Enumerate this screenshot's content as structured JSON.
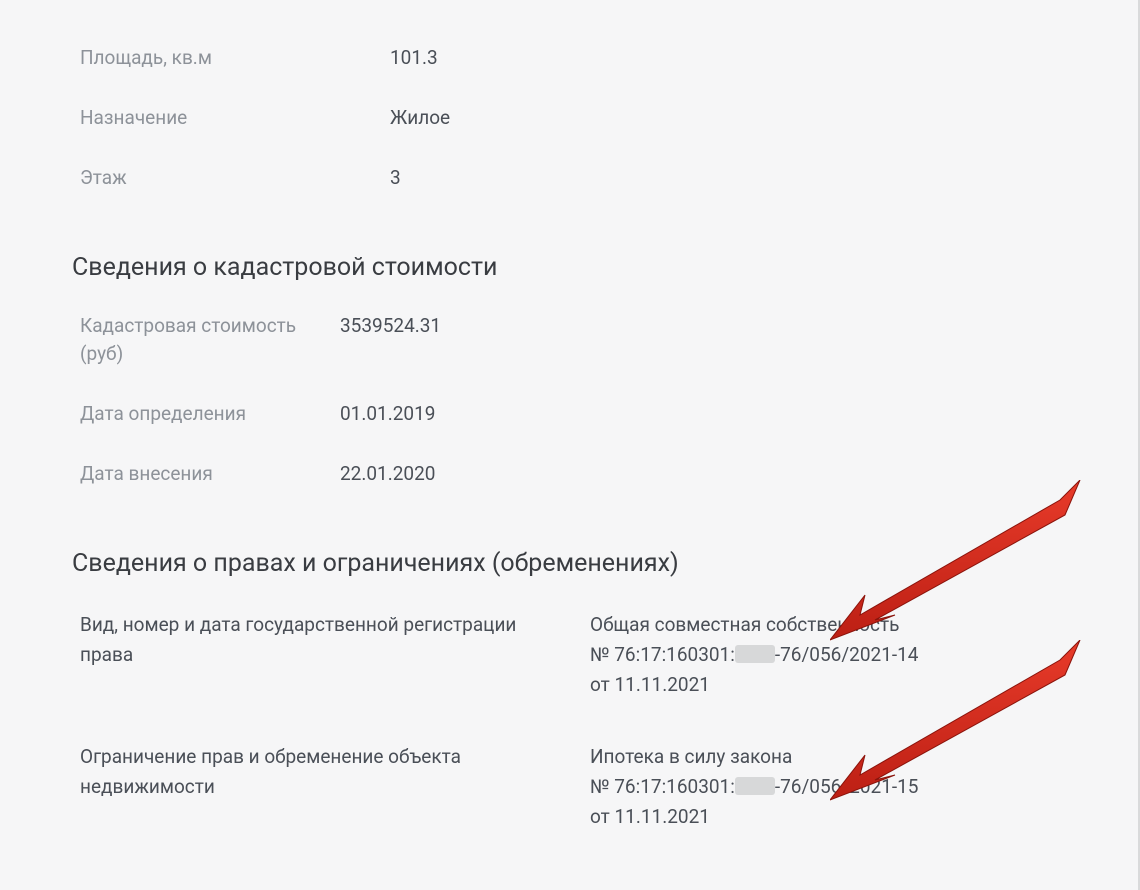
{
  "basic": {
    "area_label": "Площадь, кв.м",
    "area_value": "101.3",
    "purpose_label": "Назначение",
    "purpose_value": "Жилое",
    "floor_label": "Этаж",
    "floor_value": "3"
  },
  "cadastral": {
    "section_title": "Сведения о кадастровой стоимости",
    "cost_label": "Кадастровая стоимость (руб)",
    "cost_value": "3539524.31",
    "determination_date_label": "Дата определения",
    "determination_date_value": "01.01.2019",
    "entry_date_label": "Дата внесения",
    "entry_date_value": "22.01.2020"
  },
  "rights": {
    "section_title": "Сведения о правах и ограничениях (обременениях)",
    "reg_label": "Вид, номер и дата государственной регистрации права",
    "reg_value_line1": "Общая совместная собственность",
    "reg_value_line2_prefix": "№ 76:17:160301:",
    "reg_value_line2_suffix": "-76/056/2021-14",
    "reg_value_line3": "от 11.11.2021",
    "encum_label": "Ограничение прав и обременение объекта недвижимости",
    "encum_value_line1": "Ипотека в силу закона",
    "encum_value_line2_prefix": "№ 76:17:160301:",
    "encum_value_line2_suffix": "-76/056/2021-15",
    "encum_value_line3": "от 11.11.2021"
  }
}
